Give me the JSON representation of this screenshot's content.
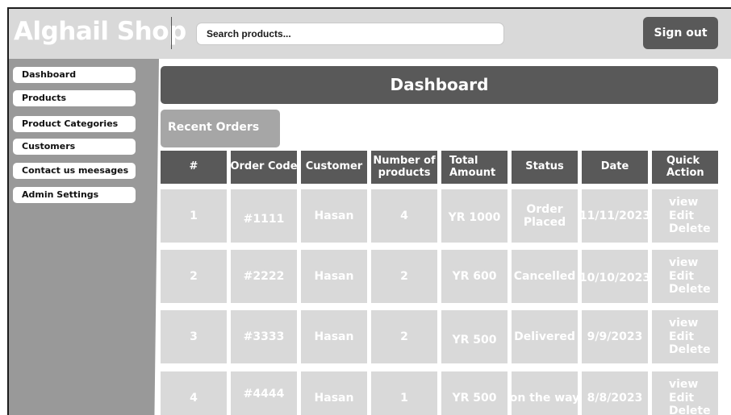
{
  "header": {
    "brand": "Alghail Shop",
    "search_placeholder": "Search products...",
    "signout_label": "Sign out"
  },
  "sidebar": {
    "items": [
      {
        "label": "Dashboard"
      },
      {
        "label": "Products"
      },
      {
        "label": "Product Categories"
      },
      {
        "label": "Customers"
      },
      {
        "label": "Contact us meesages"
      },
      {
        "label": "Admin Settings"
      }
    ]
  },
  "main": {
    "title": "Dashboard",
    "recent_orders_label": "Recent Orders",
    "table": {
      "columns": [
        "#",
        "Order Code",
        "Customer",
        "Number of products",
        "Total Amount",
        "Status",
        "Date",
        "Quick Action"
      ],
      "rows": [
        {
          "num": "1",
          "code": "#1111",
          "customer": "Hasan",
          "products": "4",
          "amount": "YR 1000",
          "status": "Order Placed",
          "date": "11/11/2023"
        },
        {
          "num": "2",
          "code": "#2222",
          "customer": "Hasan",
          "products": "2",
          "amount": "YR 600",
          "status": "Cancelled",
          "date": "10/10/2023"
        },
        {
          "num": "3",
          "code": "#3333",
          "customer": "Hasan",
          "products": "2",
          "amount": "YR 500",
          "status": "Delivered",
          "date": "9/9/2023"
        },
        {
          "num": "4",
          "code": "#4444",
          "customer": "Hasan",
          "products": "1",
          "amount": "YR 500",
          "status": "on the way",
          "date": "8/8/2023"
        }
      ],
      "actions": {
        "view": "view",
        "edit": "Edit",
        "delete": "Delete"
      }
    }
  },
  "colors": {
    "header_bg": "#d9d9d9",
    "sidebar_bg": "#999999",
    "dark": "#595959",
    "cell_bg": "#d9d9d9"
  }
}
